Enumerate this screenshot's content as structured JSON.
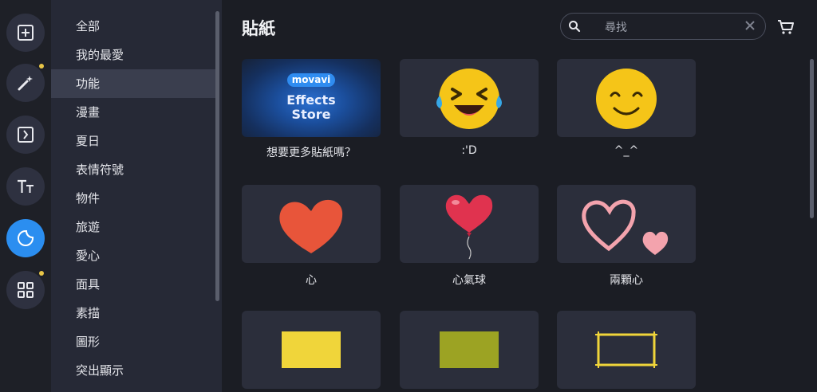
{
  "rail": {
    "items": [
      {
        "icon": "add-media-icon",
        "active": false,
        "notify": false
      },
      {
        "icon": "magic-wand-icon",
        "active": false,
        "notify": true
      },
      {
        "icon": "transition-icon",
        "active": false,
        "notify": false
      },
      {
        "icon": "titles-icon",
        "active": false,
        "notify": false
      },
      {
        "icon": "stickers-icon",
        "active": true,
        "notify": false
      },
      {
        "icon": "more-tools-icon",
        "active": false,
        "notify": true
      }
    ]
  },
  "categories": [
    "全部",
    "我的最愛",
    "功能",
    "漫畫",
    "夏日",
    "表情符號",
    "物件",
    "旅遊",
    "愛心",
    "面具",
    "素描",
    "圖形",
    "突出顯示"
  ],
  "active_category": "功能",
  "header": {
    "title": "貼紙"
  },
  "search": {
    "placeholder": "尋找"
  },
  "tiles": [
    {
      "caption": "想要更多貼紙嗎？",
      "brand": "movavi",
      "line1": "Effects",
      "line2": "Store"
    },
    {
      "caption": ":'D"
    },
    {
      "caption": "^_^"
    },
    {
      "caption": "心"
    },
    {
      "caption": "心氣球"
    },
    {
      "caption": "兩顆心"
    },
    {
      "caption": ""
    },
    {
      "caption": ""
    },
    {
      "caption": ""
    }
  ],
  "colors": {
    "accent": "#2b8ef0",
    "emoji_yellow": "#f5c518",
    "heart_orange": "#e8553a",
    "balloon_red": "#e0334f",
    "outline_pink": "#f3a3ad",
    "rect_yellow": "#f0d53a",
    "rect_olive": "#9ca323"
  }
}
